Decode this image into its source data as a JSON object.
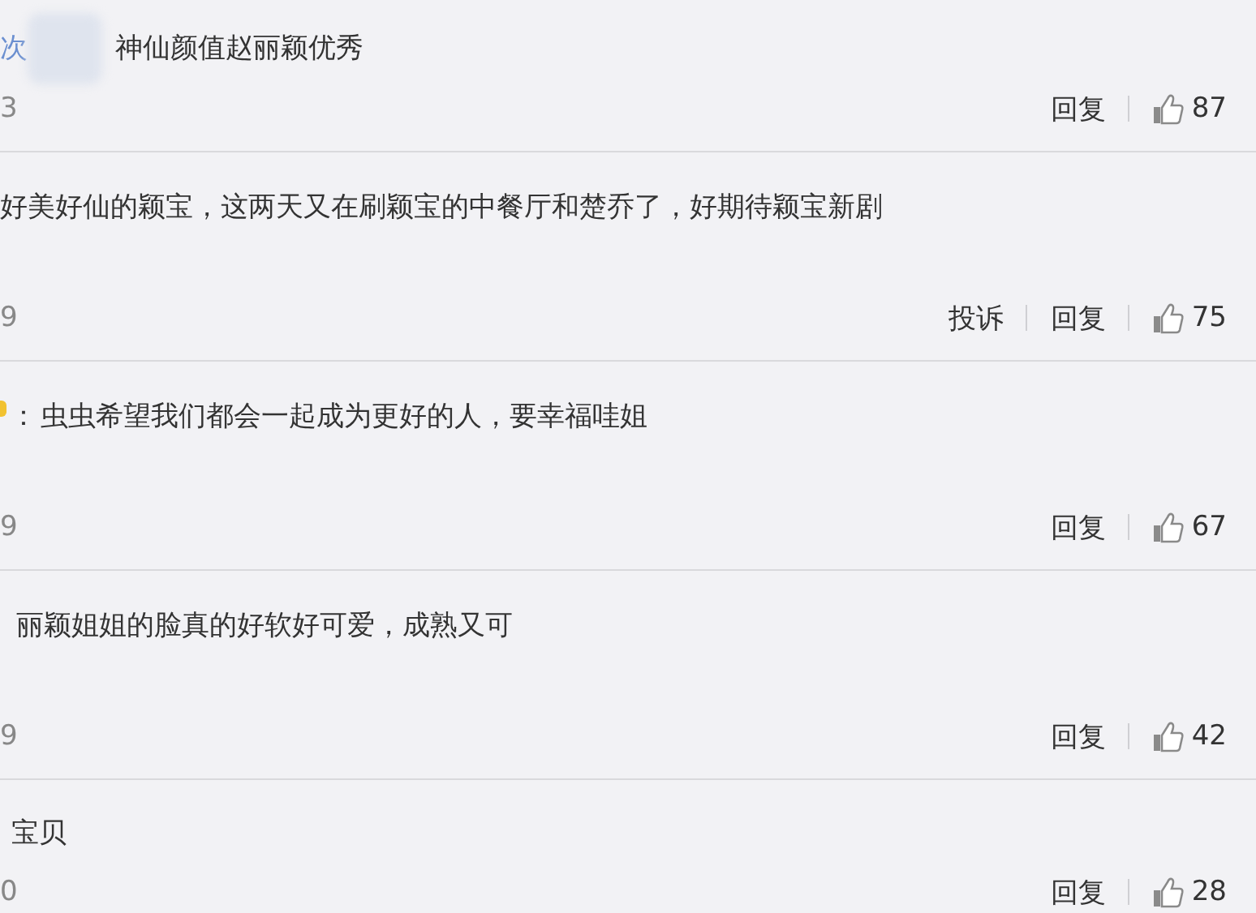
{
  "comments": [
    {
      "author": "次",
      "redacted": true,
      "text": "神仙颜值赵丽颖优秀",
      "time": "3",
      "actions": [
        "回复"
      ],
      "likes": "87"
    },
    {
      "text": "好美好仙的颖宝，这两天又在刷颖宝的中餐厅和楚乔了，好期待颖宝新剧",
      "time": "9",
      "actions": [
        "投诉",
        "回复"
      ],
      "likes": "75"
    },
    {
      "lead_icon": true,
      "lead": "：",
      "text": "虫虫希望我们都会一起成为更好的人，要幸福哇姐",
      "time": "9",
      "actions": [
        "回复"
      ],
      "likes": "67"
    },
    {
      "text": "丽颖姐姐的脸真的好软好可爱，成熟又可",
      "time": "9",
      "actions": [
        "回复"
      ],
      "likes": "42"
    },
    {
      "text": "宝贝",
      "time": "0",
      "actions": [
        "回复"
      ],
      "likes": "28"
    }
  ]
}
